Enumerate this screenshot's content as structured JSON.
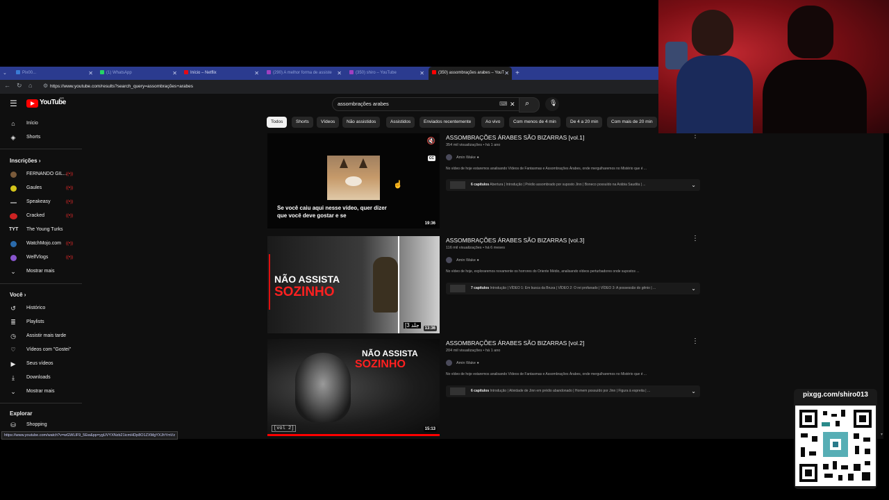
{
  "browser": {
    "tabs": [
      {
        "label": "Pix00...",
        "color": "#3a7bd5"
      },
      {
        "label": "(1) WhatsApp",
        "color": "#25d366"
      },
      {
        "label": "Início – Netflix",
        "color": "#e50914"
      },
      {
        "label": "(290) A melhor forma de assiste",
        "color": "#a040c0"
      },
      {
        "label": "(350) shiro – YouTube",
        "color": "#a040c0"
      },
      {
        "label": "(350) assombrações arabes – YouT",
        "color": "#ff0000"
      }
    ],
    "new_tab": "+",
    "url": "https://www.youtube.com/results?search_query=assombrações+arabes"
  },
  "youtube": {
    "logo": "YouTube",
    "region": "BR",
    "search_query": "assombrações arabes",
    "sidebar": {
      "top": [
        {
          "label": "Início",
          "icon": "home-icon",
          "glyph": "⌂"
        },
        {
          "label": "Shorts",
          "icon": "shorts-icon",
          "glyph": "◈"
        }
      ],
      "subscriptions_title": "Inscrições",
      "subscriptions": [
        {
          "label": "FERNANDO GIL...",
          "color": "#7a5a3a"
        },
        {
          "label": "Gaules",
          "color": "#d4c41a"
        },
        {
          "label": "Speakeasy",
          "color": "#222222"
        },
        {
          "label": "Cracked",
          "color": "#cc2222"
        },
        {
          "label": "The Young Turks",
          "color": "#333333"
        },
        {
          "label": "WatchMojo.com",
          "color": "#2a6aaa"
        },
        {
          "label": "WelfVlogs",
          "color": "#8855cc"
        }
      ],
      "subs_more": "Mostrar mais",
      "you_title": "Você",
      "you_items": [
        {
          "label": "Histórico",
          "icon": "history-icon",
          "glyph": "↺"
        },
        {
          "label": "Playlists",
          "icon": "playlists-icon",
          "glyph": "≣"
        },
        {
          "label": "Assistir mais tarde",
          "icon": "clock-icon",
          "glyph": "◷"
        },
        {
          "label": "Vídeos com \"Gostei\"",
          "icon": "like-icon",
          "glyph": "👍"
        },
        {
          "label": "Seus vídeos",
          "icon": "video-icon",
          "glyph": "▶"
        },
        {
          "label": "Downloads",
          "icon": "download-icon",
          "glyph": "⤓"
        }
      ],
      "you_more": "Mostrar mais",
      "explore_title": "Explorar",
      "explore_items": [
        {
          "label": "Shopping",
          "icon": "bag-icon",
          "glyph": "⛁"
        }
      ]
    },
    "chips": [
      "Todos",
      "Shorts",
      "Vídeos",
      "Não assistidos",
      "Assistidos",
      "Enviados recentemente",
      "Ao vivo",
      "Com menos de 4 min",
      "De 4 a 20 min",
      "Com mais de 20 min"
    ],
    "results": [
      {
        "title": "ASSOMBRAÇÕES ÁRABES SÃO BIZARRAS [vol.1]",
        "meta": "354 mil visualizações • há 1 ano",
        "channel": "Amin Wake",
        "desc": "No vídeo de hoje estaremos analisando Vídeos de Fantasmas e Assombrações Árabes, onde mergulharemos no Mistério que é ...",
        "chapters_count": "6 capítulos",
        "chapters": "Abertura | Introdução | Prédio assombrado por suposto Jinn | Boneco possuído na Arábia Saudita | ...",
        "duration": "19:36",
        "caption": "Se você caiu aqui nesse vídeo, quer dizer que você deve gostar e se",
        "cc": "CC"
      },
      {
        "title": "ASSOMBRAÇÕES ÁRABES SÃO BIZARRAS [vol.3]",
        "meta": "116 mil visualizações • há 6 meses",
        "channel": "Amin Wake",
        "desc": "No vídeo de hoje, exploraremos novamente os horrores do Oriente Médio, analisando vídeos perturbadores onde supostos ...",
        "chapters_count": "7 capítulos",
        "chapters": "Introdução | VÍDEO 1: Em busca da Bruxa | VÍDEO 2: O rei profanado | VÍDEO 3: A possessão do gênio | ...",
        "duration": "13:36",
        "thumb_line1": "NÃO ASSISTA",
        "thumb_line2": "SOZINHO",
        "badge": "[3 جلد"
      },
      {
        "title": "ASSOMBRAÇÕES ÁRABES SÃO BIZARRAS [vol.2]",
        "meta": "204 mil visualizações • há 1 ano",
        "channel": "Amin Wake",
        "desc": "No vídeo de hoje estaremos analisando Vídeos de Fantasmas e Assombrações Árabes, onde mergulharemos no Mistério que é ...",
        "chapters_count": "6 capítulos",
        "chapters": "Introdução | Atividade de Jinn em prédio abandonado | Homem possuído por Jinn | Figura à espreita | ...",
        "duration": "15:13",
        "thumb_line1": "NÃO ASSISTA",
        "thumb_line2": "SOZINHO",
        "badge": "[vol 2]"
      }
    ],
    "status_url": "https://www.youtube.com/watch?v=wGWLlF9_5Ew&pp=ygUVYXNzb21icmHDp8O1ZXMgYXJhYmVz"
  },
  "overlay": {
    "pix_label": "pixgg.com/shiro013"
  },
  "colors": {
    "youtube_red": "#ff0000",
    "tabbar": "#2b3b8f",
    "page_bg": "#0f0f0f"
  }
}
